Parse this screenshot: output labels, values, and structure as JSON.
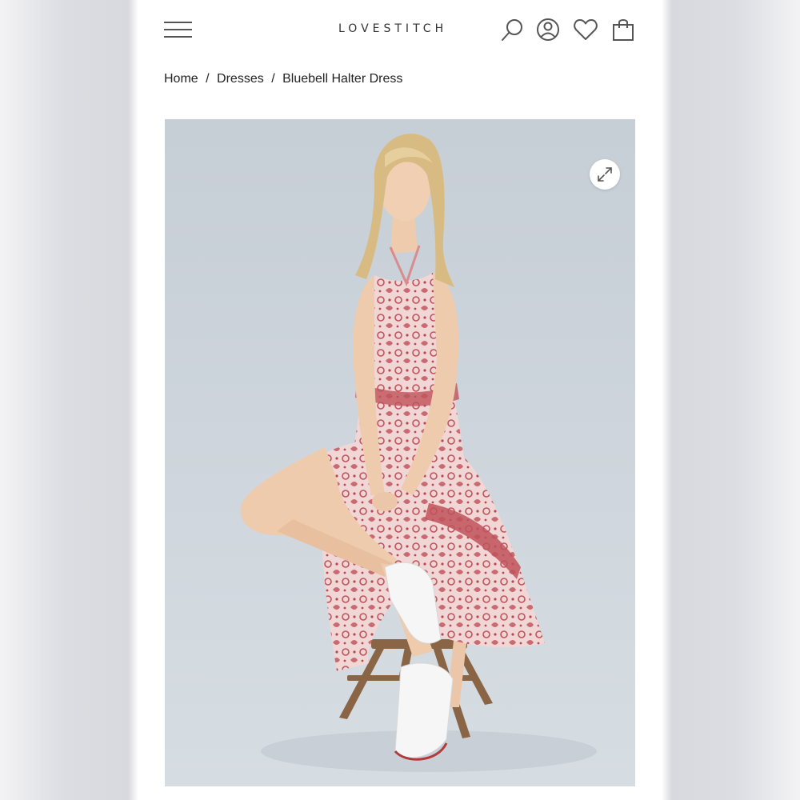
{
  "header": {
    "brand": "LOVESTITCH",
    "icons": [
      "menu-icon",
      "search-icon",
      "account-icon",
      "wishlist-icon",
      "bag-icon"
    ]
  },
  "breadcrumb": {
    "items": [
      "Home",
      "Dresses",
      "Bluebell Halter Dress"
    ],
    "separator": "/"
  },
  "product": {
    "zoom_icon": "expand-icon"
  },
  "colors": {
    "text": "#222222",
    "icon": "#555555",
    "background": "#ffffff",
    "photo_backdrop": "#c9d1d8",
    "dress_print": "#c0525a"
  }
}
